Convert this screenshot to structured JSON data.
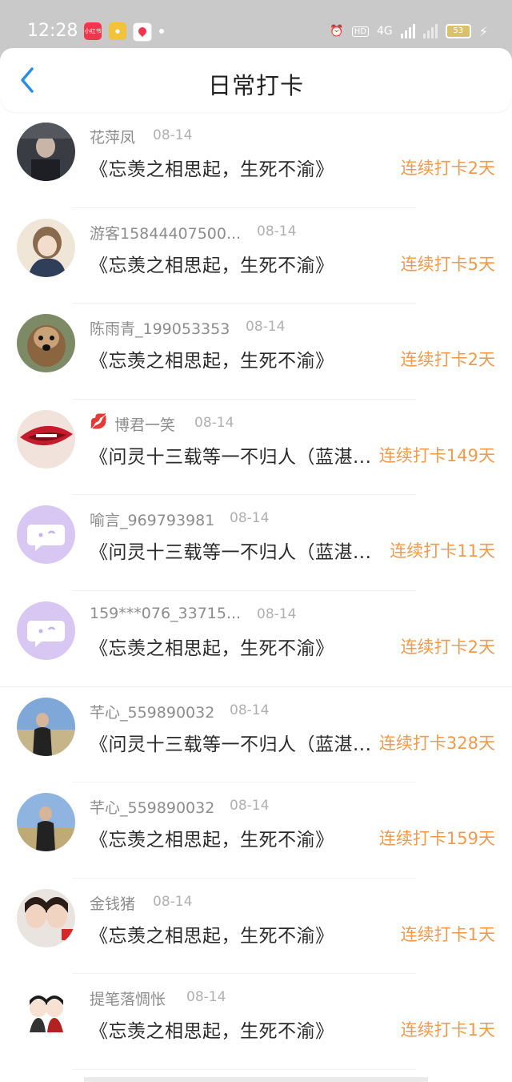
{
  "status_bar": {
    "time": "12:28",
    "apps": [
      "xiaohongshu-icon",
      "weibo-icon",
      "map-icon"
    ],
    "hd_label": "HD",
    "signal_label": "4G",
    "battery": "53"
  },
  "header": {
    "title": "日常打卡",
    "back_icon": "chevron-left-icon"
  },
  "rows": [
    {
      "name": "花萍凤",
      "date": "08-14",
      "text": "《忘羡之相思起，生死不渝》",
      "streak": "连续打卡2天"
    },
    {
      "name": "游客15844407500...",
      "date": "08-14",
      "text": "《忘羡之相思起，生死不渝》",
      "streak": "连续打卡5天"
    },
    {
      "name": "陈雨青_199053353",
      "date": "08-14",
      "text": "《忘羡之相思起，生死不渝》",
      "streak": "连续打卡2天"
    },
    {
      "name": "博君一笑",
      "date": "08-14",
      "text": "《问灵十三载等一不归人（蓝湛...",
      "streak": "连续打卡149天"
    },
    {
      "name": "喻言_969793981",
      "date": "08-14",
      "text": "《问灵十三载等一不归人（蓝湛...",
      "streak": "连续打卡11天"
    },
    {
      "name": "159***076_33715...",
      "date": "08-14",
      "text": "《忘羡之相思起，生死不渝》",
      "streak": "连续打卡2天"
    },
    {
      "name": "芊心_559890032",
      "date": "08-14",
      "text": "《问灵十三载等一不归人（蓝湛...",
      "streak": "连续打卡328天"
    },
    {
      "name": "芊心_559890032",
      "date": "08-14",
      "text": "《忘羡之相思起，生死不渝》",
      "streak": "连续打卡159天"
    },
    {
      "name": "金钱猪",
      "date": "08-14",
      "text": "《忘羡之相思起，生死不渝》",
      "streak": "连续打卡1天"
    },
    {
      "name": "提笔落惆怅",
      "date": "08-14",
      "text": "《忘羡之相思起，生死不渝》",
      "streak": "连续打卡1天"
    }
  ],
  "colors": {
    "streak": "#f09a4e",
    "accent": "#2b8ee6",
    "default_avatar": "#d8c6f3"
  }
}
